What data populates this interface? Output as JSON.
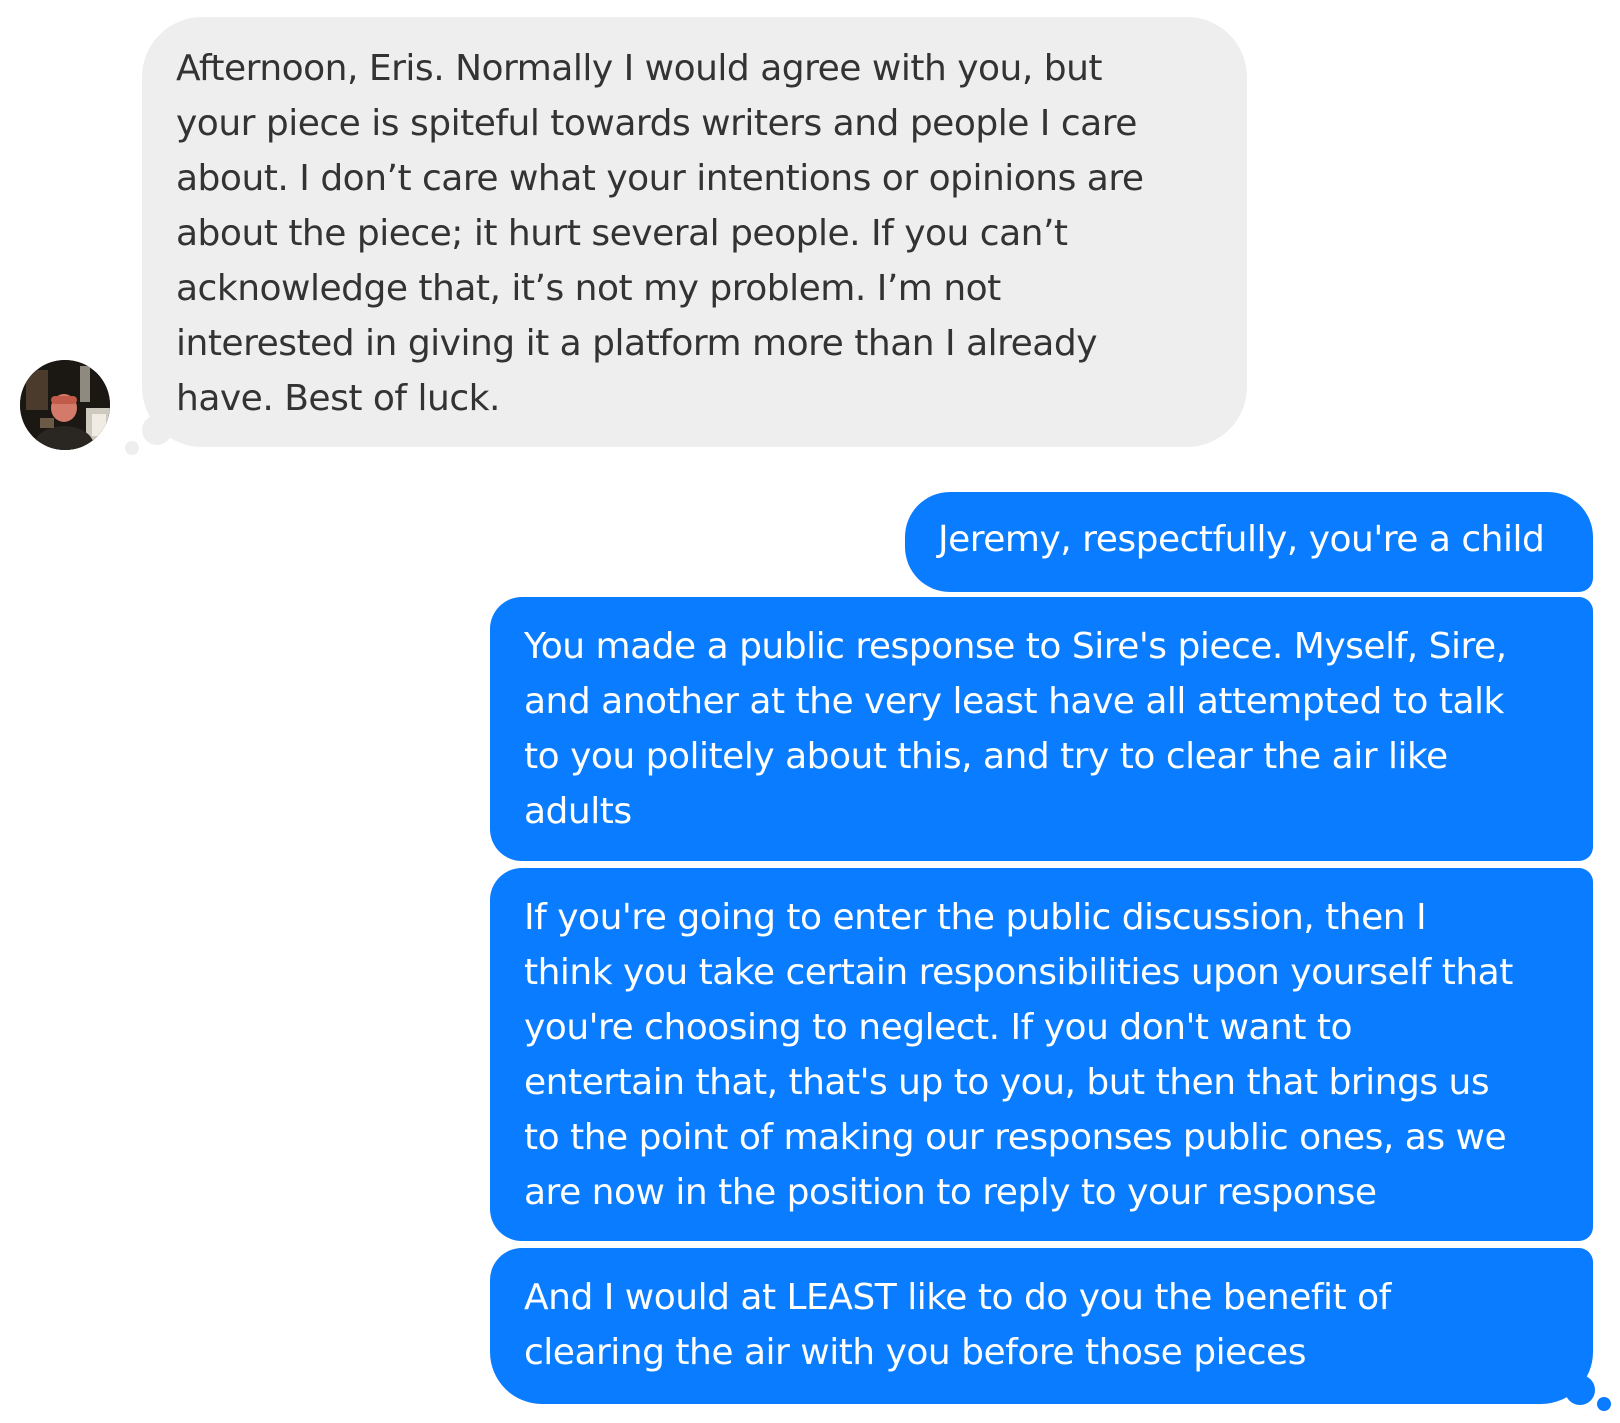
{
  "conversation": {
    "incoming": {
      "text": "Afternoon, Eris. Normally I would agree with you, but\nyour piece is spiteful towards writers and people I care\nabout. I don’t care what your intentions or opinions are\nabout the piece; it hurt several people. If you can’t\nacknowledge that, it’s not my problem. I’m not\ninterested in giving it a platform more than I already\nhave. Best of luck."
    },
    "outgoing": [
      {
        "text": "Jeremy, respectfully, you're a child"
      },
      {
        "text": "You made a public response to Sire's piece. Myself, Sire,\nand another at the very least have all attempted to talk\nto you politely about this, and try to clear the air like\nadults"
      },
      {
        "text": "If you're going to enter the public discussion, then I\nthink you take certain responsibilities upon yourself that\nyou're choosing to neglect. If you don't want to\nentertain that, that's up to you, but then that brings us\nto the point of making our responses public ones, as we\nare now in the position to reply to your response"
      },
      {
        "text": "And I would at LEAST like to do you the benefit of\nclearing the air with you before those pieces"
      }
    ]
  },
  "colors": {
    "incoming_bubble": "#eeeeee",
    "incoming_text": "#333333",
    "outgoing_bubble": "#0a7cff",
    "outgoing_text": "#ffffff",
    "background": "#ffffff"
  },
  "icons": {
    "sender_avatar": "avatar",
    "seen_indicator": "thought-tail-dots"
  }
}
